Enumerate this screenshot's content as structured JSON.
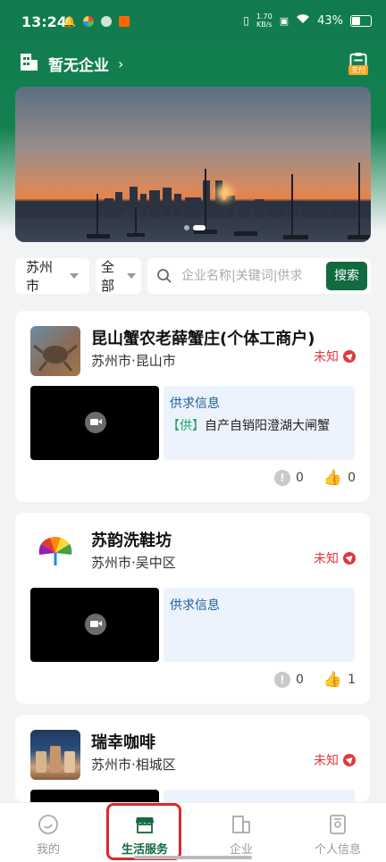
{
  "status_bar": {
    "time": "13:24",
    "speed": "1.70\nKB/s",
    "battery": "43%"
  },
  "header": {
    "title": "暂无企业",
    "chevron": "›",
    "pay_label": "支付"
  },
  "filters": {
    "city": "苏州市",
    "category": "全部",
    "search_placeholder": "企业名称|关键词|供求",
    "search_button": "搜索"
  },
  "cards": [
    {
      "name": "昆山蟹农老薛蟹庄(个体工商户)",
      "location": "苏州市·昆山市",
      "status": "未知",
      "info_title": "供求信息",
      "info_tag": "【供】",
      "info_text": "自产自销阳澄湖大闸蟹",
      "warn_count": "0",
      "like_count": "0"
    },
    {
      "name": "苏韵洗鞋坊",
      "location": "苏州市·吴中区",
      "status": "未知",
      "info_title": "供求信息",
      "info_tag": "",
      "info_text": "",
      "warn_count": "0",
      "like_count": "1"
    },
    {
      "name": "瑞幸咖啡",
      "location": "苏州市·相城区",
      "status": "未知"
    }
  ],
  "nav": [
    {
      "label": "我的",
      "icon": "smile-icon"
    },
    {
      "label": "生活服务",
      "icon": "shop-icon"
    },
    {
      "label": "企业",
      "icon": "building-icon"
    },
    {
      "label": "个人信息",
      "icon": "profile-doc-icon"
    }
  ],
  "colors": {
    "brand_green": "#126a40",
    "alert_red": "#e0383e",
    "highlight_red": "#d92b2b"
  }
}
